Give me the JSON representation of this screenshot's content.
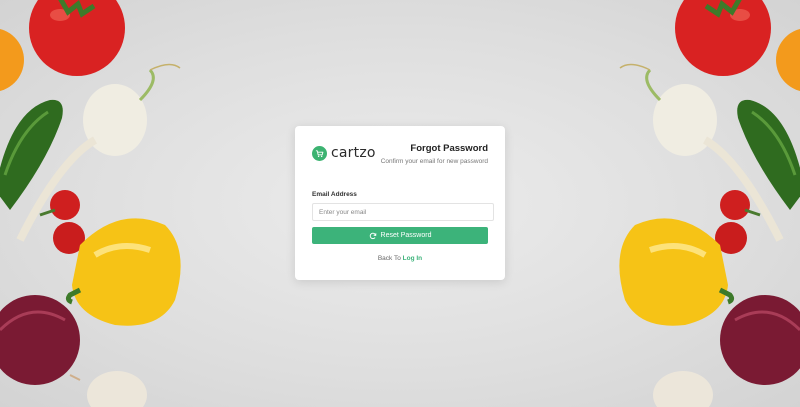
{
  "brand": {
    "name": "cartzo",
    "accent": "#3cb371"
  },
  "header": {
    "title": "Forgot Password",
    "subtitle": "Confirm your email for new password"
  },
  "form": {
    "email_label": "Email Address",
    "email_placeholder": "Enter your email",
    "email_value": "",
    "reset_button_label": "Reset Password",
    "reset_button_icon": "refresh-icon"
  },
  "footer": {
    "back_prefix": "Back To",
    "login_link": "Log In"
  },
  "background": {
    "description_icons": [
      "tomato-icon",
      "cucumber-icon",
      "turnip-icon",
      "yellow-pepper-icon",
      "red-onion-icon",
      "cherry-tomato-icon",
      "orange-icon",
      "mushroom-icon"
    ]
  }
}
